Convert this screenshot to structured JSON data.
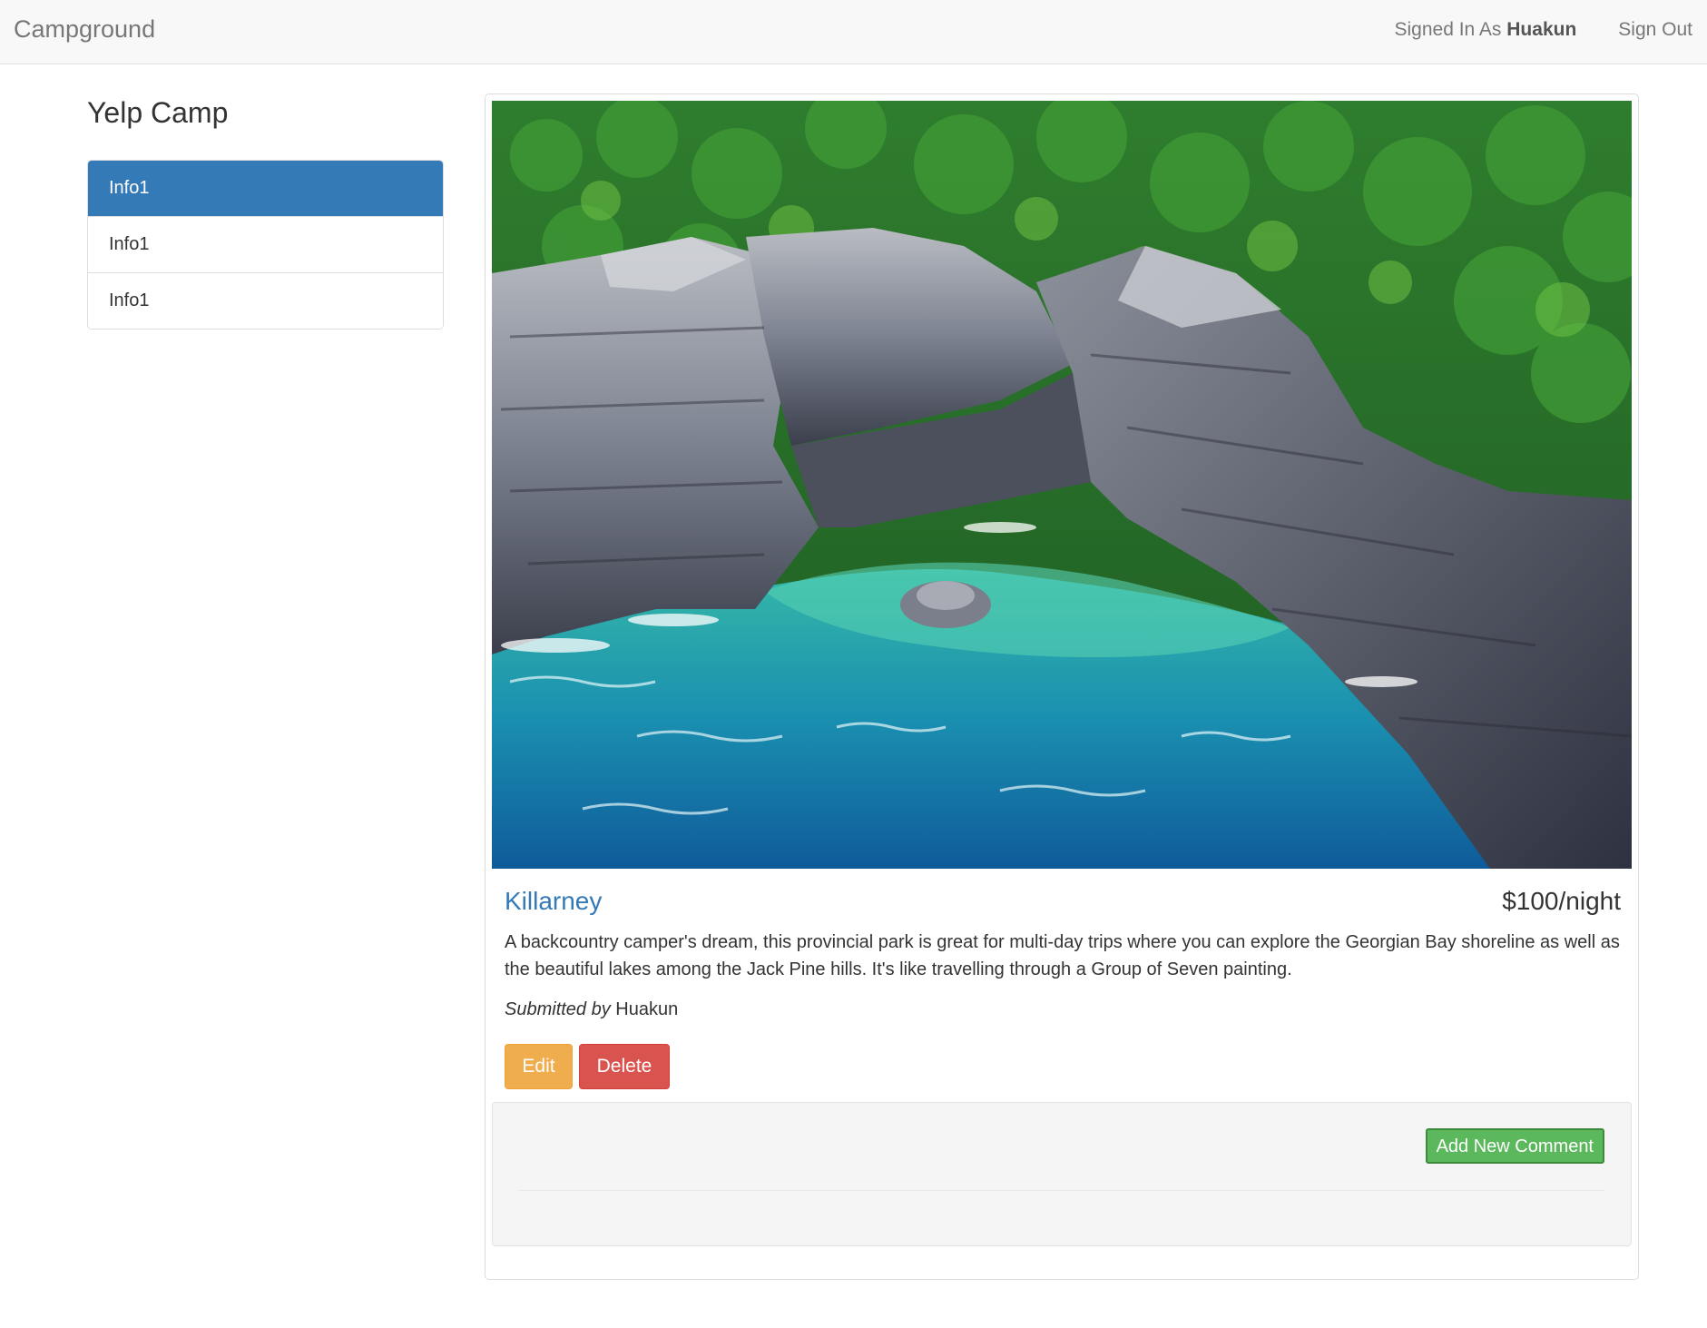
{
  "navbar": {
    "brand": "Campground",
    "signed_in_prefix": "Signed In As ",
    "username": "Huakun",
    "sign_out": "Sign Out"
  },
  "sidebar": {
    "title": "Yelp Camp",
    "items": [
      {
        "label": "Info1",
        "active": true
      },
      {
        "label": "Info1",
        "active": false
      },
      {
        "label": "Info1",
        "active": false
      }
    ]
  },
  "campground": {
    "image_alt": "Rocky cliffs with forest above turquoise water",
    "name": "Killarney",
    "price": "$100/night",
    "description": "A backcountry camper's dream, this provincial park is great for multi-day trips where you can explore the Georgian Bay shoreline as well as the beautiful lakes among the Jack Pine hills. It's like travelling through a Group of Seven painting.",
    "submitted_label": "Submitted by",
    "author": "Huakun"
  },
  "actions": {
    "edit": "Edit",
    "delete": "Delete"
  },
  "comments": {
    "add_button": "Add New Comment"
  },
  "colors": {
    "primary": "#337ab7",
    "warning": "#f0ad4e",
    "danger": "#d9534f",
    "success": "#5cb85c"
  }
}
